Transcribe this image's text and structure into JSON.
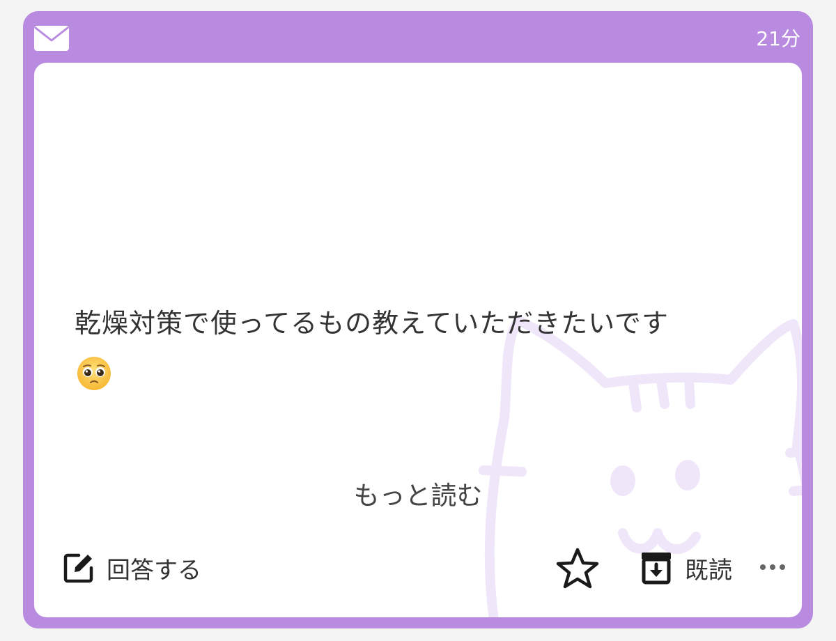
{
  "card": {
    "accent_color": "#b98be0",
    "header": {
      "icon": "envelope-icon",
      "time": "21分"
    },
    "question_text": "乾燥対策で使ってるもの教えていただきたいです",
    "emoji": "pleading-face-emoji",
    "read_more_label": "もっと読む",
    "watermark": "cat-face-illustration"
  },
  "actions": {
    "answer": {
      "icon": "edit-icon",
      "label": "回答する"
    },
    "favorite": {
      "icon": "star-icon"
    },
    "mark_read": {
      "icon": "archive-icon",
      "label": "既読"
    },
    "more": {
      "icon": "more-horizontal-icon"
    }
  }
}
